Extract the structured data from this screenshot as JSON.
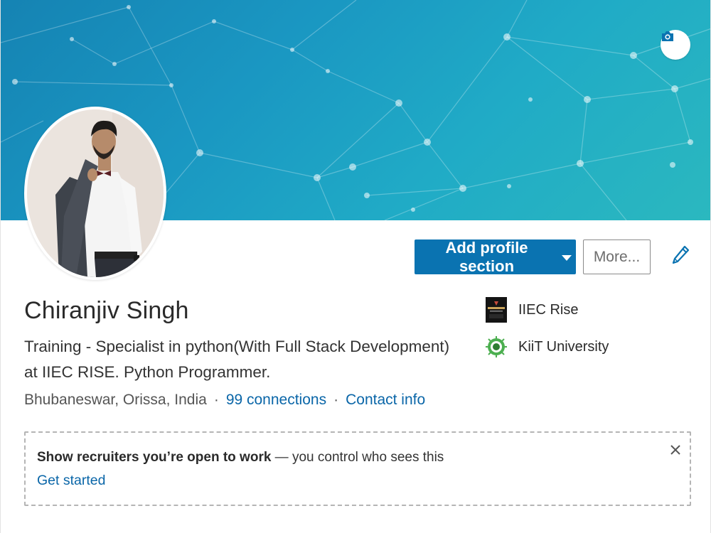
{
  "profile": {
    "name": "Chiranjiv Singh",
    "headline": "Training - Specialist in python(With Full Stack Development) at IIEC RISE. Python Programmer.",
    "location": "Bhubaneswar, Orissa, India",
    "separator": "·",
    "connections": "99 connections",
    "contact_info": "Contact info"
  },
  "actions": {
    "add_section_label": "Add profile section",
    "more_label": "More..."
  },
  "organizations": [
    {
      "name": "IIEC Rise",
      "icon": "iiec-rise-logo"
    },
    {
      "name": "KiiT University",
      "icon": "kiit-university-logo"
    }
  ],
  "open_to_work": {
    "bold_text": "Show recruiters you’re open to work",
    "rest_text": " — you control who sees this",
    "link_label": "Get started"
  },
  "icons": {
    "camera": "camera-icon",
    "edit": "pencil-icon",
    "close": "close-icon",
    "dropdown": "caret-down-icon"
  },
  "colors": {
    "primary": "#0a73b1",
    "link": "#0a66a8",
    "banner_start": "#1583b3",
    "banner_end": "#2bb8bf"
  }
}
